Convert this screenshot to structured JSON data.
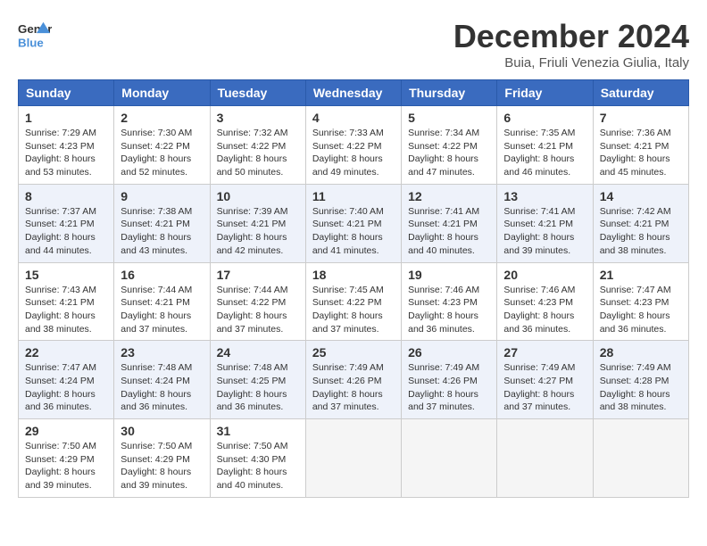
{
  "header": {
    "logo_general": "General",
    "logo_blue": "Blue",
    "month_title": "December 2024",
    "subtitle": "Buia, Friuli Venezia Giulia, Italy"
  },
  "weekdays": [
    "Sunday",
    "Monday",
    "Tuesday",
    "Wednesday",
    "Thursday",
    "Friday",
    "Saturday"
  ],
  "weeks": [
    [
      {
        "day": "1",
        "sunrise": "Sunrise: 7:29 AM",
        "sunset": "Sunset: 4:23 PM",
        "daylight": "Daylight: 8 hours and 53 minutes."
      },
      {
        "day": "2",
        "sunrise": "Sunrise: 7:30 AM",
        "sunset": "Sunset: 4:22 PM",
        "daylight": "Daylight: 8 hours and 52 minutes."
      },
      {
        "day": "3",
        "sunrise": "Sunrise: 7:32 AM",
        "sunset": "Sunset: 4:22 PM",
        "daylight": "Daylight: 8 hours and 50 minutes."
      },
      {
        "day": "4",
        "sunrise": "Sunrise: 7:33 AM",
        "sunset": "Sunset: 4:22 PM",
        "daylight": "Daylight: 8 hours and 49 minutes."
      },
      {
        "day": "5",
        "sunrise": "Sunrise: 7:34 AM",
        "sunset": "Sunset: 4:22 PM",
        "daylight": "Daylight: 8 hours and 47 minutes."
      },
      {
        "day": "6",
        "sunrise": "Sunrise: 7:35 AM",
        "sunset": "Sunset: 4:21 PM",
        "daylight": "Daylight: 8 hours and 46 minutes."
      },
      {
        "day": "7",
        "sunrise": "Sunrise: 7:36 AM",
        "sunset": "Sunset: 4:21 PM",
        "daylight": "Daylight: 8 hours and 45 minutes."
      }
    ],
    [
      {
        "day": "8",
        "sunrise": "Sunrise: 7:37 AM",
        "sunset": "Sunset: 4:21 PM",
        "daylight": "Daylight: 8 hours and 44 minutes."
      },
      {
        "day": "9",
        "sunrise": "Sunrise: 7:38 AM",
        "sunset": "Sunset: 4:21 PM",
        "daylight": "Daylight: 8 hours and 43 minutes."
      },
      {
        "day": "10",
        "sunrise": "Sunrise: 7:39 AM",
        "sunset": "Sunset: 4:21 PM",
        "daylight": "Daylight: 8 hours and 42 minutes."
      },
      {
        "day": "11",
        "sunrise": "Sunrise: 7:40 AM",
        "sunset": "Sunset: 4:21 PM",
        "daylight": "Daylight: 8 hours and 41 minutes."
      },
      {
        "day": "12",
        "sunrise": "Sunrise: 7:41 AM",
        "sunset": "Sunset: 4:21 PM",
        "daylight": "Daylight: 8 hours and 40 minutes."
      },
      {
        "day": "13",
        "sunrise": "Sunrise: 7:41 AM",
        "sunset": "Sunset: 4:21 PM",
        "daylight": "Daylight: 8 hours and 39 minutes."
      },
      {
        "day": "14",
        "sunrise": "Sunrise: 7:42 AM",
        "sunset": "Sunset: 4:21 PM",
        "daylight": "Daylight: 8 hours and 38 minutes."
      }
    ],
    [
      {
        "day": "15",
        "sunrise": "Sunrise: 7:43 AM",
        "sunset": "Sunset: 4:21 PM",
        "daylight": "Daylight: 8 hours and 38 minutes."
      },
      {
        "day": "16",
        "sunrise": "Sunrise: 7:44 AM",
        "sunset": "Sunset: 4:21 PM",
        "daylight": "Daylight: 8 hours and 37 minutes."
      },
      {
        "day": "17",
        "sunrise": "Sunrise: 7:44 AM",
        "sunset": "Sunset: 4:22 PM",
        "daylight": "Daylight: 8 hours and 37 minutes."
      },
      {
        "day": "18",
        "sunrise": "Sunrise: 7:45 AM",
        "sunset": "Sunset: 4:22 PM",
        "daylight": "Daylight: 8 hours and 37 minutes."
      },
      {
        "day": "19",
        "sunrise": "Sunrise: 7:46 AM",
        "sunset": "Sunset: 4:23 PM",
        "daylight": "Daylight: 8 hours and 36 minutes."
      },
      {
        "day": "20",
        "sunrise": "Sunrise: 7:46 AM",
        "sunset": "Sunset: 4:23 PM",
        "daylight": "Daylight: 8 hours and 36 minutes."
      },
      {
        "day": "21",
        "sunrise": "Sunrise: 7:47 AM",
        "sunset": "Sunset: 4:23 PM",
        "daylight": "Daylight: 8 hours and 36 minutes."
      }
    ],
    [
      {
        "day": "22",
        "sunrise": "Sunrise: 7:47 AM",
        "sunset": "Sunset: 4:24 PM",
        "daylight": "Daylight: 8 hours and 36 minutes."
      },
      {
        "day": "23",
        "sunrise": "Sunrise: 7:48 AM",
        "sunset": "Sunset: 4:24 PM",
        "daylight": "Daylight: 8 hours and 36 minutes."
      },
      {
        "day": "24",
        "sunrise": "Sunrise: 7:48 AM",
        "sunset": "Sunset: 4:25 PM",
        "daylight": "Daylight: 8 hours and 36 minutes."
      },
      {
        "day": "25",
        "sunrise": "Sunrise: 7:49 AM",
        "sunset": "Sunset: 4:26 PM",
        "daylight": "Daylight: 8 hours and 37 minutes."
      },
      {
        "day": "26",
        "sunrise": "Sunrise: 7:49 AM",
        "sunset": "Sunset: 4:26 PM",
        "daylight": "Daylight: 8 hours and 37 minutes."
      },
      {
        "day": "27",
        "sunrise": "Sunrise: 7:49 AM",
        "sunset": "Sunset: 4:27 PM",
        "daylight": "Daylight: 8 hours and 37 minutes."
      },
      {
        "day": "28",
        "sunrise": "Sunrise: 7:49 AM",
        "sunset": "Sunset: 4:28 PM",
        "daylight": "Daylight: 8 hours and 38 minutes."
      }
    ],
    [
      {
        "day": "29",
        "sunrise": "Sunrise: 7:50 AM",
        "sunset": "Sunset: 4:29 PM",
        "daylight": "Daylight: 8 hours and 39 minutes."
      },
      {
        "day": "30",
        "sunrise": "Sunrise: 7:50 AM",
        "sunset": "Sunset: 4:29 PM",
        "daylight": "Daylight: 8 hours and 39 minutes."
      },
      {
        "day": "31",
        "sunrise": "Sunrise: 7:50 AM",
        "sunset": "Sunset: 4:30 PM",
        "daylight": "Daylight: 8 hours and 40 minutes."
      },
      null,
      null,
      null,
      null
    ]
  ]
}
